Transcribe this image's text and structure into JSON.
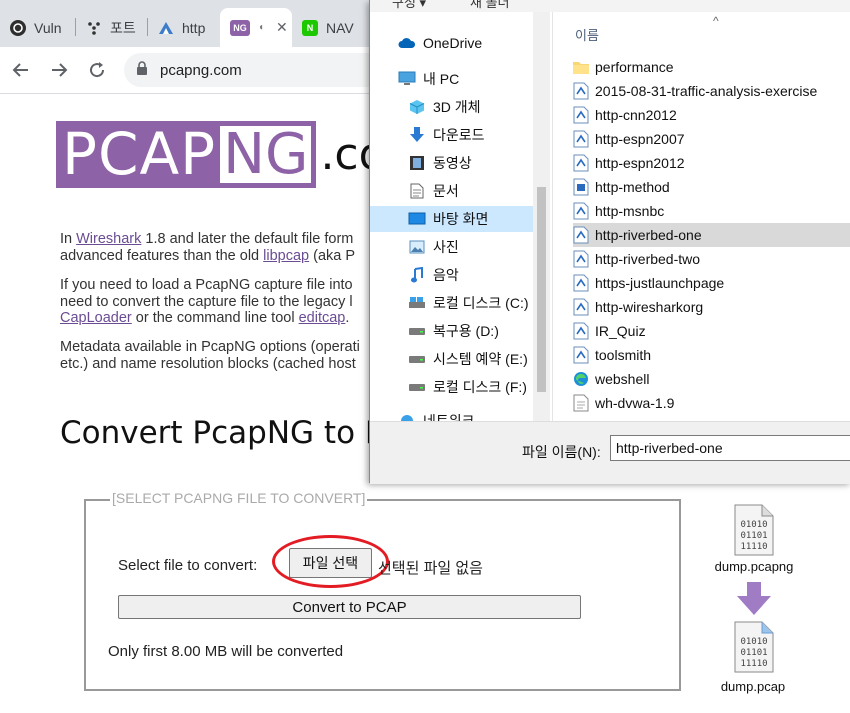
{
  "browser": {
    "tabs": [
      {
        "label": "Vuln",
        "favicon": "vulnhub-icon",
        "color": "#2e2e2e"
      },
      {
        "label": "포트",
        "favicon": "tree-dots-icon",
        "color": "#3c3c3c"
      },
      {
        "label": "http",
        "favicon": "shark-fin-icon",
        "color": "#3d7cc9"
      },
      {
        "label": "NG",
        "favicon": "pcapng-icon",
        "color": "#8e62a6"
      },
      {
        "label": "NAV",
        "favicon": "naver-icon",
        "color": "#1ec800"
      }
    ],
    "active_tab_favicon_text": "NG",
    "naver_favicon_text": "N",
    "url": "pcapng.com"
  },
  "page": {
    "logo_pcap": "PCAP",
    "logo_ng": "NG",
    "logo_tld": ".com",
    "p1_line1_pre": "In ",
    "p1_link1": "Wireshark",
    "p1_line1_post": " 1.8 and later the default file form",
    "p1_line2_pre": "advanced features than the old ",
    "p1_link2": "libpcap",
    "p1_line2_post": " (aka P",
    "p2_line1": "If you need to load a PcapNG capture file into",
    "p2_line2": "need to convert the capture file to the legacy l",
    "p2_link1": "CapLoader",
    "p2_line3_mid": " or the command line tool ",
    "p2_link2": "editcap",
    "p2_line3_post": ".",
    "p3_line1": "Metadata available in PcapNG options (operati",
    "p3_line2": "etc.) and name resolution blocks (cached host",
    "convert_title": "Convert PcapNG to PC",
    "form": {
      "legend": "[SELECT PCAPNG FILE TO CONVERT]",
      "select_label": "Select file to convert:",
      "file_button": "파일 선택",
      "no_file": "선택된 파일 없음",
      "convert_button": "Convert to PCAP",
      "limit_note": "Only first 8.00 MB will be converted"
    },
    "graphic": {
      "source_name": "dump.pcapng",
      "target_name": "dump.pcap",
      "binary_line1": "01010",
      "binary_line2": "01101",
      "binary_line3": "11110",
      "arrow_color": "#a07cc5"
    }
  },
  "dialog": {
    "top_labels": [
      "구성 ▾",
      "새 폴더"
    ],
    "nav_items": [
      {
        "label": "OneDrive",
        "icon": "cloud-icon"
      },
      {
        "label": "내 PC",
        "icon": "computer-icon"
      },
      {
        "label": "3D 개체",
        "icon": "cube-icon"
      },
      {
        "label": "다운로드",
        "icon": "download-arrow-icon"
      },
      {
        "label": "동영상",
        "icon": "film-icon"
      },
      {
        "label": "문서",
        "icon": "document-icon"
      },
      {
        "label": "바탕 화면",
        "icon": "desktop-icon",
        "selected": true
      },
      {
        "label": "사진",
        "icon": "picture-icon"
      },
      {
        "label": "음악",
        "icon": "music-note-icon"
      },
      {
        "label": "로컬 디스크 (C:)",
        "icon": "drive-icon"
      },
      {
        "label": "복구용 (D:)",
        "icon": "drive-icon"
      },
      {
        "label": "시스템 예약 (E:)",
        "icon": "drive-icon"
      },
      {
        "label": "로컬 디스크 (F:)",
        "icon": "drive-icon"
      },
      {
        "label": "네트워크",
        "icon": "network-icon"
      }
    ],
    "column_header": "이름",
    "files": [
      {
        "name": "performance",
        "icon": "folder-icon"
      },
      {
        "name": "2015-08-31-traffic-analysis-exercise",
        "icon": "wireshark-file-icon"
      },
      {
        "name": "http-cnn2012",
        "icon": "wireshark-file-icon"
      },
      {
        "name": "http-espn2007",
        "icon": "wireshark-file-icon"
      },
      {
        "name": "http-espn2012",
        "icon": "wireshark-file-icon"
      },
      {
        "name": "http-method",
        "icon": "wireshark-file-icon"
      },
      {
        "name": "http-msnbc",
        "icon": "wireshark-file-icon"
      },
      {
        "name": "http-riverbed-one",
        "icon": "wireshark-file-icon",
        "selected": true
      },
      {
        "name": "http-riverbed-two",
        "icon": "wireshark-file-icon"
      },
      {
        "name": "https-justlaunchpage",
        "icon": "wireshark-file-icon"
      },
      {
        "name": "http-wiresharkorg",
        "icon": "wireshark-file-icon"
      },
      {
        "name": "IR_Quiz",
        "icon": "wireshark-file-icon"
      },
      {
        "name": "toolsmith",
        "icon": "wireshark-file-icon"
      },
      {
        "name": "webshell",
        "icon": "edge-icon"
      },
      {
        "name": "wh-dvwa-1.9",
        "icon": "text-file-icon"
      }
    ],
    "filename_label": "파일 이름(N):",
    "filename_value": "http-riverbed-one"
  }
}
